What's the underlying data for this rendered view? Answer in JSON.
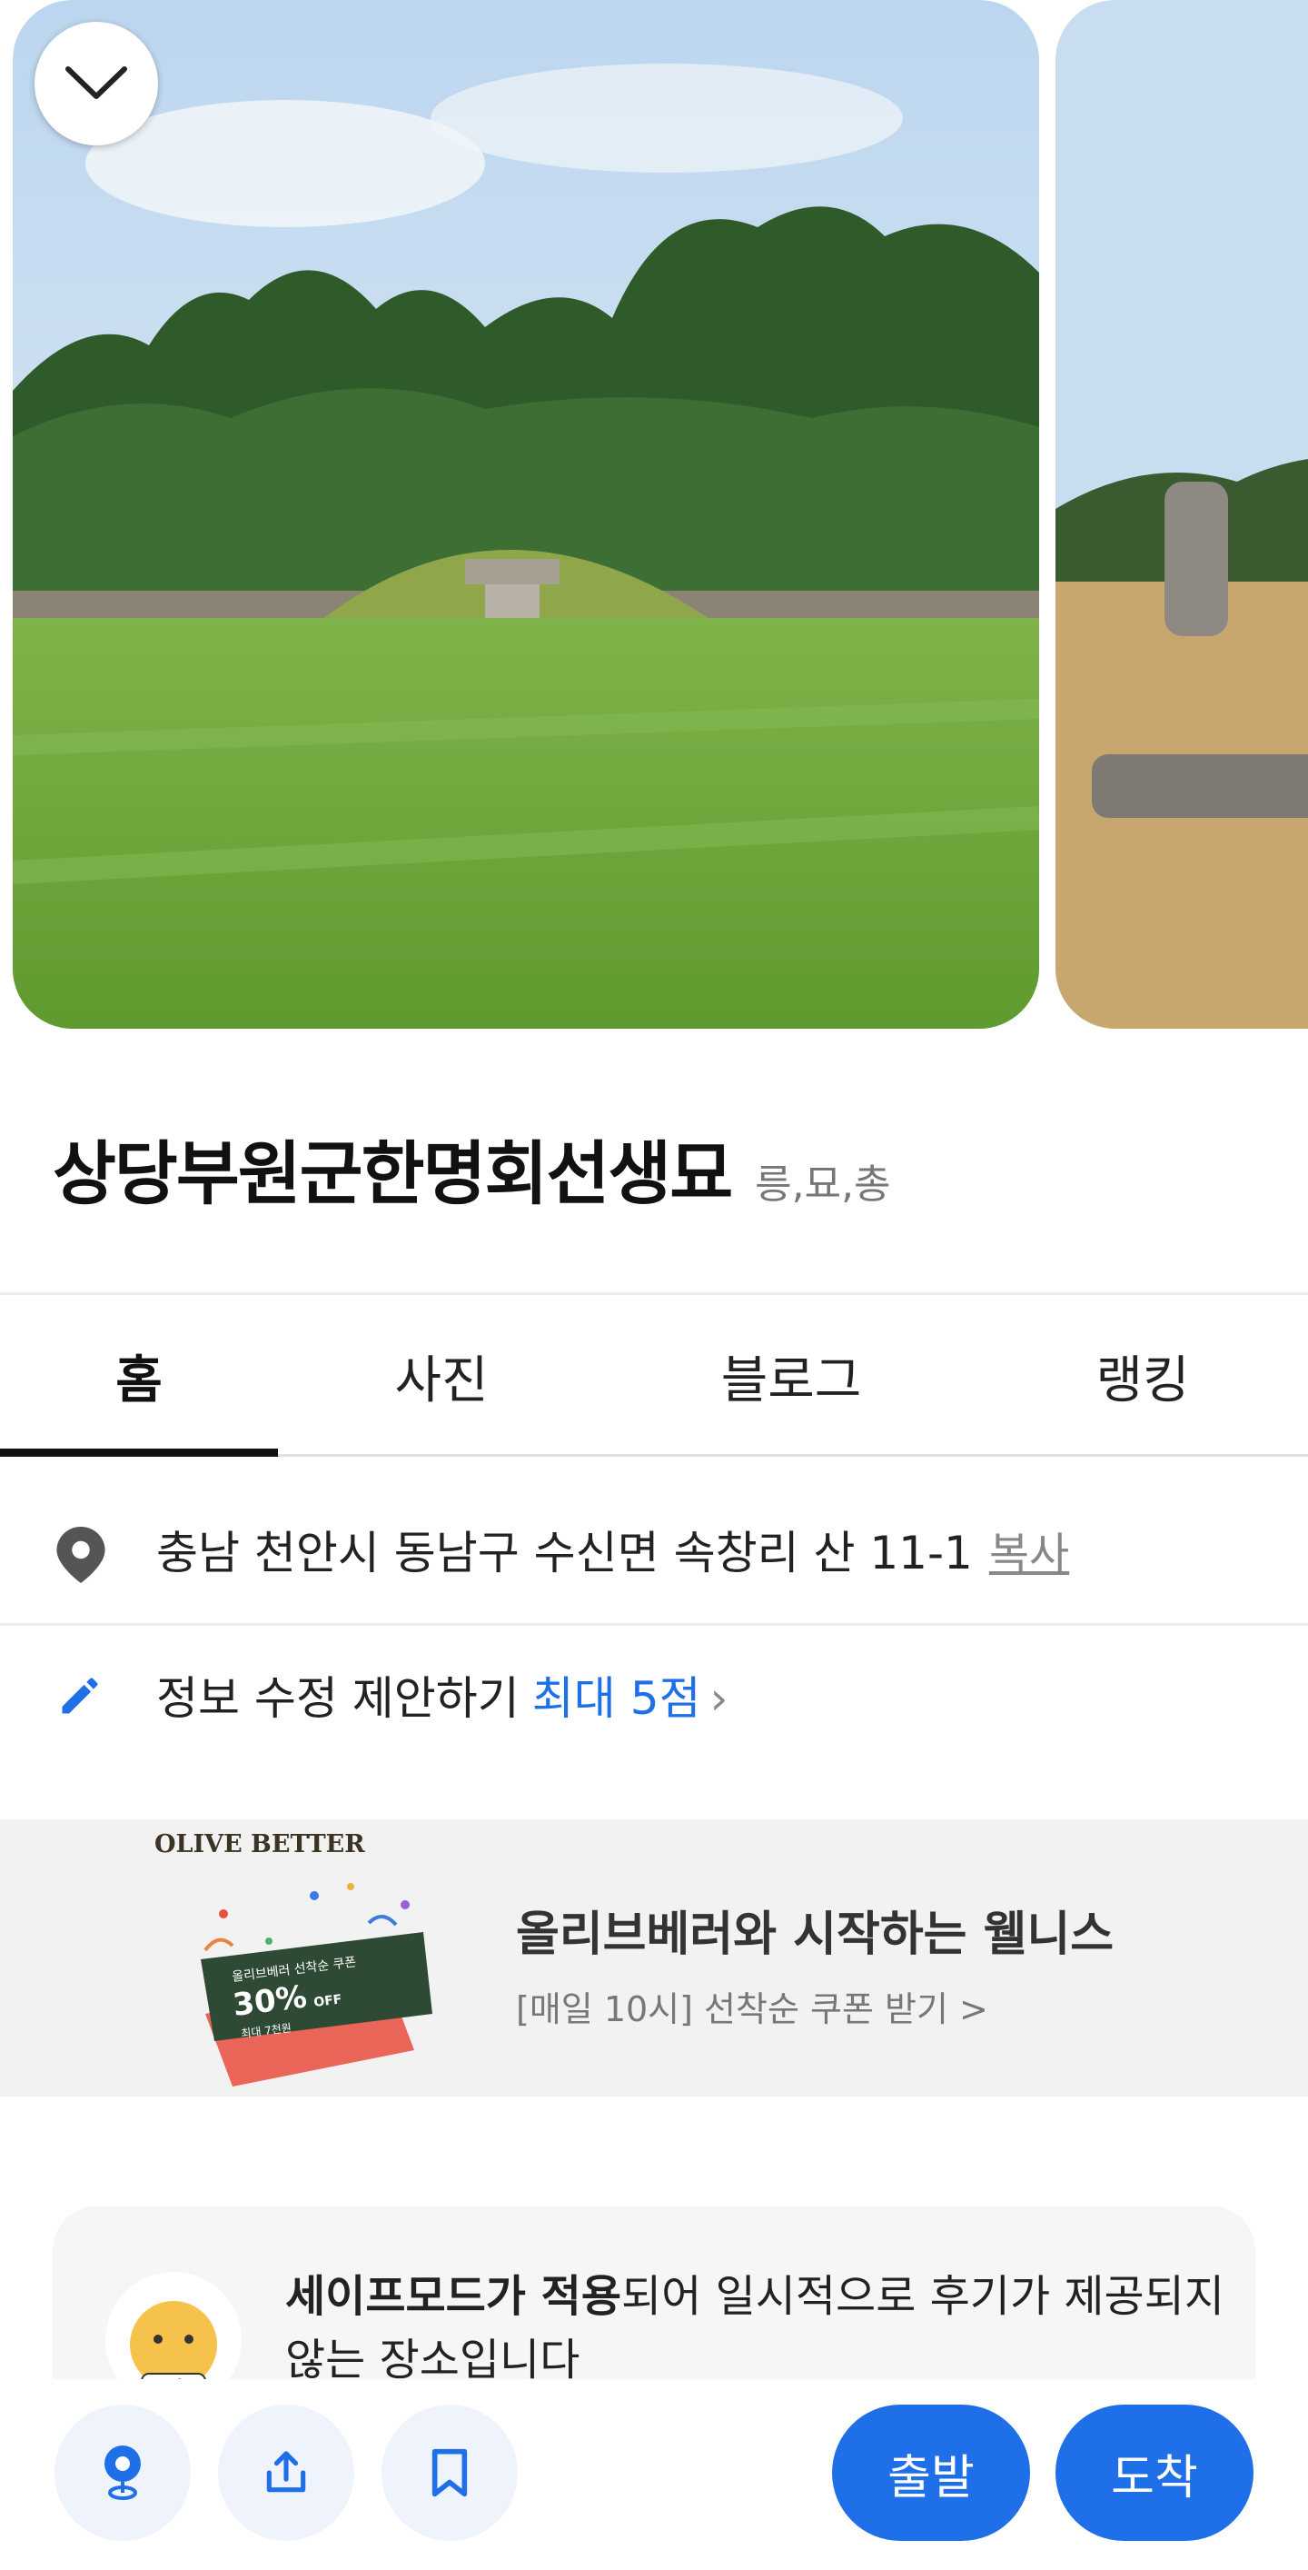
{
  "place": {
    "title": "상당부원군한명회선생묘",
    "category": "릉,묘,총"
  },
  "tabs": [
    {
      "label": "홈",
      "selected": true
    },
    {
      "label": "사진",
      "selected": false
    },
    {
      "label": "블로그",
      "selected": false
    },
    {
      "label": "랭킹",
      "selected": false
    }
  ],
  "address": {
    "text": "충남 천안시 동남구 수신면 속창리 산 11-1",
    "copy_label": "복사"
  },
  "edit_suggestion": {
    "label": "정보 수정 제안하기",
    "points": "최대 5점",
    "chevron": "›"
  },
  "ad": {
    "brand": "OLIVE BETTER",
    "coupon_line1": "올리브베러 선착순 쿠폰",
    "coupon_discount": "30%",
    "coupon_off": "OFF",
    "coupon_max": "최대 7천원",
    "title": "올리브베러와 시작하는 웰니스",
    "subtitle": "[매일 10시] 선착순 쿠폰 받기 >"
  },
  "notice": {
    "strong": "세이프모드가 적용",
    "rest": "되어 일시적으로 후기가 제공되지 않는 장소입니다",
    "mascot_label": "safe"
  },
  "actions": {
    "depart": "출발",
    "arrive": "도착"
  },
  "colors": {
    "accent": "#1e6fe8",
    "icon_bg": "#eef3fc"
  }
}
